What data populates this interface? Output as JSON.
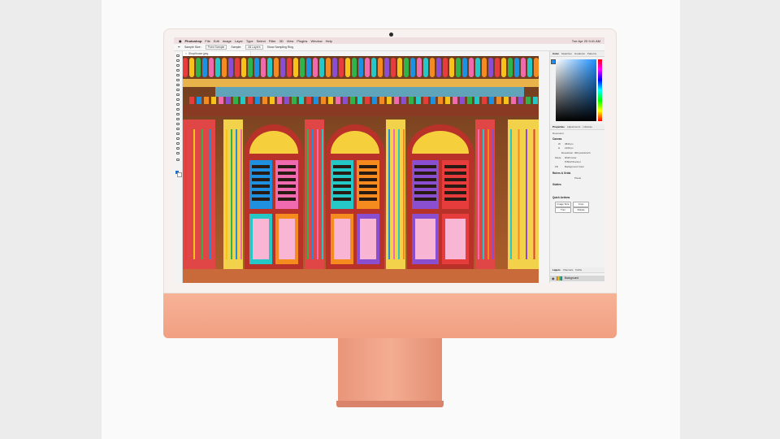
{
  "menubar": {
    "apple": "",
    "items": [
      "Photoshop",
      "File",
      "Edit",
      "Image",
      "Layer",
      "Type",
      "Select",
      "Filter",
      "3D",
      "View",
      "Plugins",
      "Window",
      "Help"
    ],
    "clock": "Tue Apr 20 9:41 AM"
  },
  "options_bar": {
    "sample_size_label": "Sample Size:",
    "sample_size_value": "Point Sample",
    "sample_label": "Sample:",
    "sample_value": "All Layers",
    "show_ring": "Show Sampling Ring"
  },
  "document": {
    "tab_title": "ShopHouse.jpeg"
  },
  "panels": {
    "color_tabs": [
      "Color",
      "Swatches",
      "Gradients",
      "Patterns"
    ],
    "props_tabs": [
      "Properties",
      "Adjustments",
      "Libraries"
    ],
    "doc_label": "Document",
    "canvas_section": "Canvas",
    "width_label": "W",
    "width_value": "3840 px",
    "height_label": "H",
    "height_value": "2160 px",
    "resolution": "Resolution: 300 pixels/inch",
    "mode_label": "Mode",
    "mode_value": "RGB Color",
    "bits_value": "8 Bits/Channel",
    "fill_label": "Fill",
    "fill_value": "Background Color",
    "rulers_section": "Rulers & Grids",
    "ruler_units": "Pixels",
    "guides_section": "Guides",
    "quick_actions_section": "Quick Actions",
    "btn_image_size": "Image Size",
    "btn_crop": "Crop",
    "btn_trim": "Trim",
    "btn_rotate": "Rotate",
    "layers_tabs": [
      "Layers",
      "Channels",
      "Paths"
    ],
    "layer_name": "Background"
  },
  "colors": {
    "chin": "#f19f82",
    "menubar": "#f0dfe0",
    "foreground": "#1a6fd0"
  }
}
